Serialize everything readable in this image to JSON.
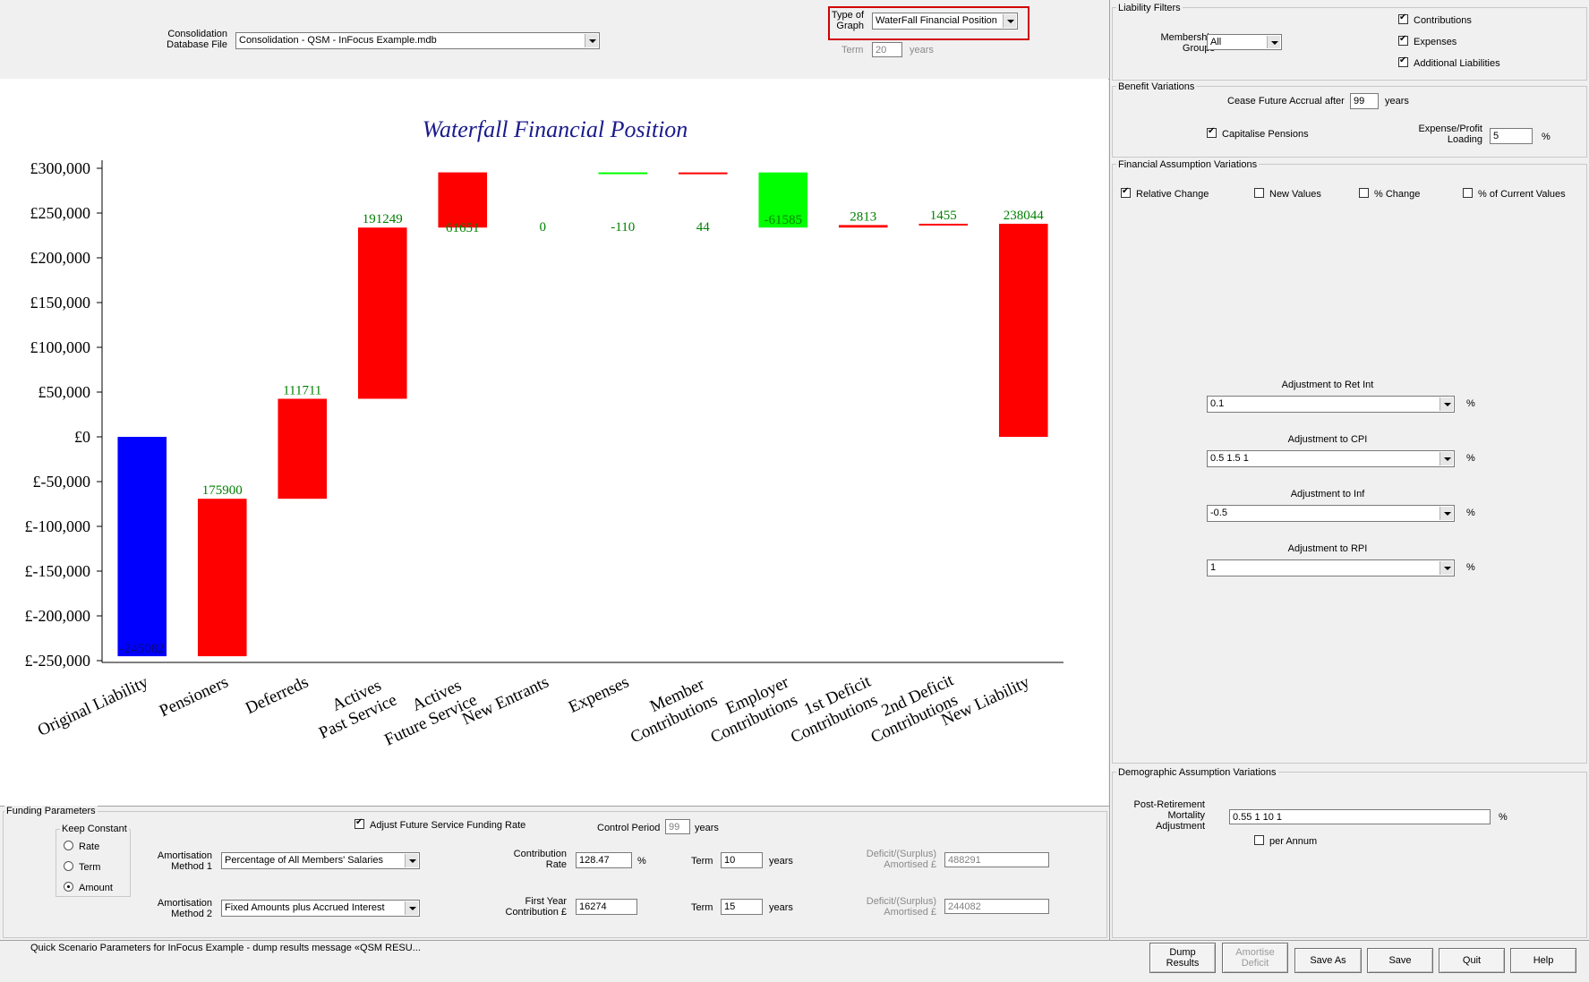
{
  "header": {
    "db_label": "Consolidation\nDatabase File",
    "db_value": "Consolidation - QSM - InFocus Example.mdb",
    "graph_type_label": "Type of\nGraph",
    "graph_type_value": "WaterFall Financial Position",
    "term_label": "Term",
    "term_value": "20",
    "term_unit": "years"
  },
  "liability_filters": {
    "title": "Liability Filters",
    "membership_label": "Membership\nGroups",
    "membership_value": "All",
    "contributions_label": "Contributions",
    "expenses_label": "Expenses",
    "additional_label": "Additional Liabilities"
  },
  "benefit_variations": {
    "title": "Benefit Variations",
    "cease_label": "Cease Future Accrual after",
    "cease_value": "99",
    "cease_unit": "years",
    "capitalise_label": "Capitalise Pensions",
    "expense_label": "Expense/Profit\nLoading",
    "expense_value": "5",
    "expense_unit": "%"
  },
  "financial_variations": {
    "title": "Financial Assumption Variations",
    "relative_label": "Relative Change",
    "new_values_label": "New Values",
    "pct_change_label": "% Change",
    "pct_current_label": "% of Current Values",
    "ret_int_label": "Adjustment to Ret Int",
    "ret_int_value": "0.1",
    "cpi_label": "Adjustment to CPI",
    "cpi_value": "0.5 1.5 1",
    "inf_label": "Adjustment to Inf",
    "inf_value": "-0.5",
    "rpi_label": "Adjustment to RPI",
    "rpi_value": "1",
    "unit": "%"
  },
  "demographic_variations": {
    "title": "Demographic Assumption Variations",
    "mortality_label": "Post-Retirement\nMortality\nAdjustment",
    "mortality_value": "0.55 1 10 1",
    "unit": "%",
    "per_annum_label": "per Annum"
  },
  "funding": {
    "title": "Funding Parameters",
    "keep_constant_title": "Keep Constant",
    "rate_label": "Rate",
    "term_label": "Term",
    "amount_label": "Amount",
    "adjust_label": "Adjust Future Service Funding Rate",
    "control_period_label": "Control Period",
    "control_period_value": "99",
    "control_period_unit": "years",
    "method1_label": "Amortisation\nMethod 1",
    "method1_value": "Percentage of All Members' Salaries",
    "method2_label": "Amortisation\nMethod 2",
    "method2_value": "Fixed Amounts plus Accrued Interest",
    "contrib_rate_label": "Contribution\nRate",
    "contrib_rate_value": "128.47",
    "contrib_rate_unit": "%",
    "first_year_label": "First Year\nContribution £",
    "first_year_value": "16274",
    "term1_label": "Term",
    "term1_value": "10",
    "term1_unit": "years",
    "term2_label": "Term",
    "term2_value": "15",
    "term2_unit": "years",
    "deficit1_label": "Deficit/(Surplus)\nAmortised £",
    "deficit1_value": "488291",
    "deficit2_label": "Deficit/(Surplus)\nAmortised £",
    "deficit2_value": "244082"
  },
  "status": {
    "text": "Quick Scenario Parameters for InFocus Example - dump results message «QSM RESU..."
  },
  "buttons": {
    "dump": "Dump\nResults",
    "amortise": "Amortise\nDeficit",
    "save_as": "Save As",
    "save": "Save",
    "quit": "Quit",
    "help": "Help"
  },
  "colors": {
    "title": "#1a1a8c",
    "increase": "#ff0000",
    "decrease": "#00ff00",
    "base": "#0000ff",
    "label": "#008000"
  },
  "chart_data": {
    "type": "bar",
    "subtype": "waterfall",
    "title": "Waterfall Financial Position",
    "categories": [
      "Original Liability",
      "Pensioners",
      "Deferreds",
      "Actives\nPast Service",
      "Actives\nFuture Service",
      "New Entrants",
      "Expenses",
      "Member\nContributions",
      "Employer\nContributions",
      "1st Deficit\nContributions",
      "2nd Deficit\nContributions",
      "New Liability"
    ],
    "values": [
      -245082,
      175900,
      111711,
      191249,
      61651,
      0,
      -110,
      44,
      -61585,
      2813,
      1455,
      238044
    ],
    "data_labels": [
      "-245082",
      "175900",
      "111711",
      "191249",
      "61651",
      "0",
      "-110",
      "44",
      "-61585",
      "2813",
      "1455",
      "238044"
    ],
    "yticks": [
      "£300,000",
      "£250,000",
      "£200,000",
      "£150,000",
      "£100,000",
      "£50,000",
      "£0",
      "£-50,000",
      "£-100,000",
      "£-150,000",
      "£-200,000",
      "£-250,000"
    ],
    "ylim": [
      -250000,
      300000
    ],
    "grid": false,
    "legend": "none"
  }
}
